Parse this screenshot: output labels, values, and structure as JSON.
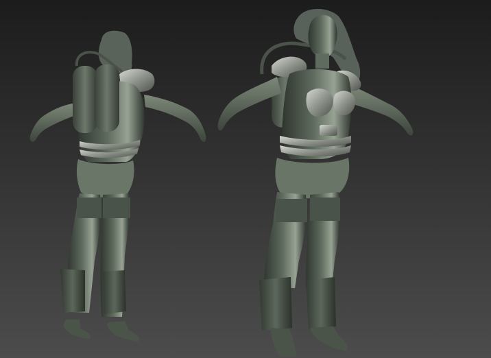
{
  "viewport": {
    "background_top": "#1c1c1c",
    "background_bottom": "#4c4c4c"
  },
  "palette": {
    "skin_shadow": "#2f362f",
    "skin_mid": "#5f6b5e",
    "skin_light": "#97a293",
    "armor_light": "#b9bdb5",
    "armor_dark": "#5a5e58"
  },
  "models": [
    {
      "label": "figure-back-view",
      "view": "back"
    },
    {
      "label": "figure-front-view",
      "view": "front"
    }
  ]
}
